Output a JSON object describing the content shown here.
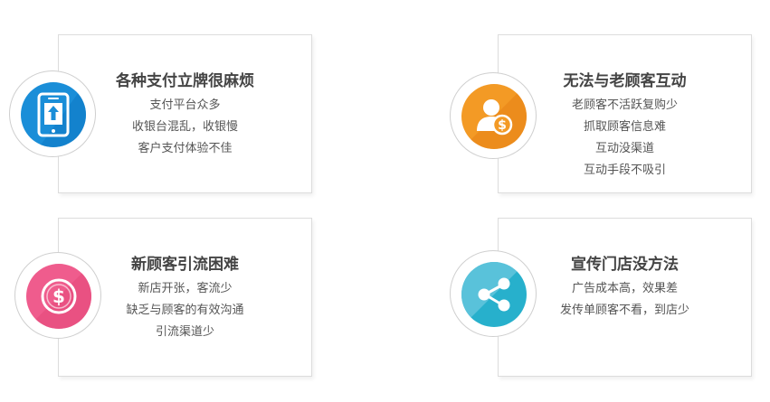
{
  "cards": [
    {
      "title": "各种支付立牌很麻烦",
      "lines": [
        "支付平台众多",
        "收银台混乱，收银慢",
        "客户支付体验不佳"
      ],
      "icon": "tablet-upload-icon",
      "color": "#1a8ed8"
    },
    {
      "title": "无法与老顾客互动",
      "lines": [
        "老顾客不活跃复购少",
        "抓取顾客信息难",
        "互动没渠道",
        "互动手段不吸引"
      ],
      "icon": "customer-dollar-icon",
      "color": "#f39a25"
    },
    {
      "title": "新顾客引流困难",
      "lines": [
        "新店开张，客流少",
        "缺乏与顾客的有效沟通",
        "引流渠道少"
      ],
      "icon": "dollar-coin-icon",
      "color": "#ef5c8d"
    },
    {
      "title": "宣传门店没方法",
      "lines": [
        "广告成本高，效果差",
        "发传单顾客不看，到店少"
      ],
      "icon": "share-icon",
      "color": "#27b0cc"
    }
  ]
}
